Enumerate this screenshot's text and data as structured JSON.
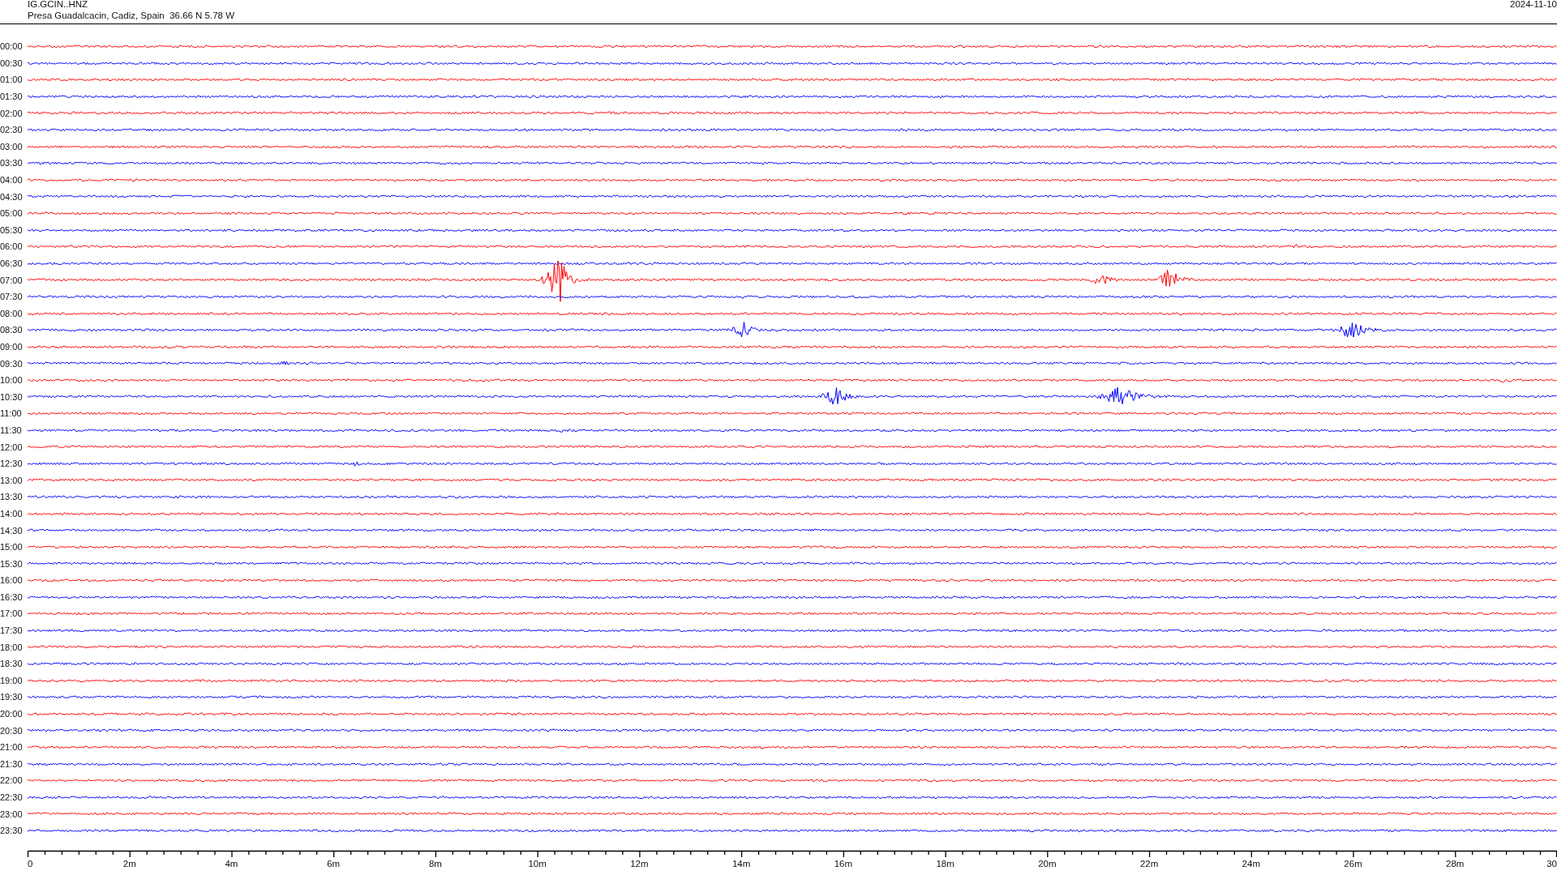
{
  "header": {
    "station": "IG.GCIN..HNZ",
    "location": "Presa Guadalcacin, Cadiz, Spain  36.66 N 5.78 W",
    "date": "2024-11-10"
  },
  "helicorder": {
    "rows": [
      {
        "time": "00:00",
        "color": "#ff0000"
      },
      {
        "time": "00:30",
        "color": "#0000ff"
      },
      {
        "time": "01:00",
        "color": "#ff0000"
      },
      {
        "time": "01:30",
        "color": "#0000ff"
      },
      {
        "time": "02:00",
        "color": "#ff0000"
      },
      {
        "time": "02:30",
        "color": "#0000ff"
      },
      {
        "time": "03:00",
        "color": "#ff0000"
      },
      {
        "time": "03:30",
        "color": "#0000ff"
      },
      {
        "time": "04:00",
        "color": "#ff0000"
      },
      {
        "time": "04:30",
        "color": "#0000ff"
      },
      {
        "time": "05:00",
        "color": "#ff0000"
      },
      {
        "time": "05:30",
        "color": "#0000ff"
      },
      {
        "time": "06:00",
        "color": "#ff0000"
      },
      {
        "time": "06:30",
        "color": "#0000ff"
      },
      {
        "time": "07:00",
        "color": "#ff0000"
      },
      {
        "time": "07:30",
        "color": "#0000ff"
      },
      {
        "time": "08:00",
        "color": "#ff0000"
      },
      {
        "time": "08:30",
        "color": "#0000ff"
      },
      {
        "time": "09:00",
        "color": "#ff0000"
      },
      {
        "time": "09:30",
        "color": "#0000ff"
      },
      {
        "time": "10:00",
        "color": "#ff0000"
      },
      {
        "time": "10:30",
        "color": "#0000ff"
      },
      {
        "time": "11:00",
        "color": "#ff0000"
      },
      {
        "time": "11:30",
        "color": "#0000ff"
      },
      {
        "time": "12:00",
        "color": "#ff0000"
      },
      {
        "time": "12:30",
        "color": "#0000ff"
      },
      {
        "time": "13:00",
        "color": "#ff0000"
      },
      {
        "time": "13:30",
        "color": "#0000ff"
      },
      {
        "time": "14:00",
        "color": "#ff0000"
      },
      {
        "time": "14:30",
        "color": "#0000ff"
      },
      {
        "time": "15:00",
        "color": "#ff0000"
      },
      {
        "time": "15:30",
        "color": "#0000ff"
      },
      {
        "time": "16:00",
        "color": "#ff0000"
      },
      {
        "time": "16:30",
        "color": "#0000ff"
      },
      {
        "time": "17:00",
        "color": "#ff0000"
      },
      {
        "time": "17:30",
        "color": "#0000ff"
      },
      {
        "time": "18:00",
        "color": "#ff0000"
      },
      {
        "time": "18:30",
        "color": "#0000ff"
      },
      {
        "time": "19:00",
        "color": "#ff0000"
      },
      {
        "time": "19:30",
        "color": "#0000ff"
      },
      {
        "time": "20:00",
        "color": "#ff0000"
      },
      {
        "time": "20:30",
        "color": "#0000ff"
      },
      {
        "time": "21:00",
        "color": "#ff0000"
      },
      {
        "time": "21:30",
        "color": "#0000ff"
      },
      {
        "time": "22:00",
        "color": "#ff0000"
      },
      {
        "time": "22:30",
        "color": "#0000ff"
      },
      {
        "time": "23:00",
        "color": "#ff0000"
      },
      {
        "time": "23:30",
        "color": "#0000ff"
      }
    ],
    "x_axis": {
      "labels": [
        "0",
        "2m",
        "4m",
        "6m",
        "8m",
        "10m",
        "12m",
        "14m",
        "16m",
        "18m",
        "20m",
        "22m",
        "24m",
        "26m",
        "28m",
        "30"
      ]
    }
  }
}
